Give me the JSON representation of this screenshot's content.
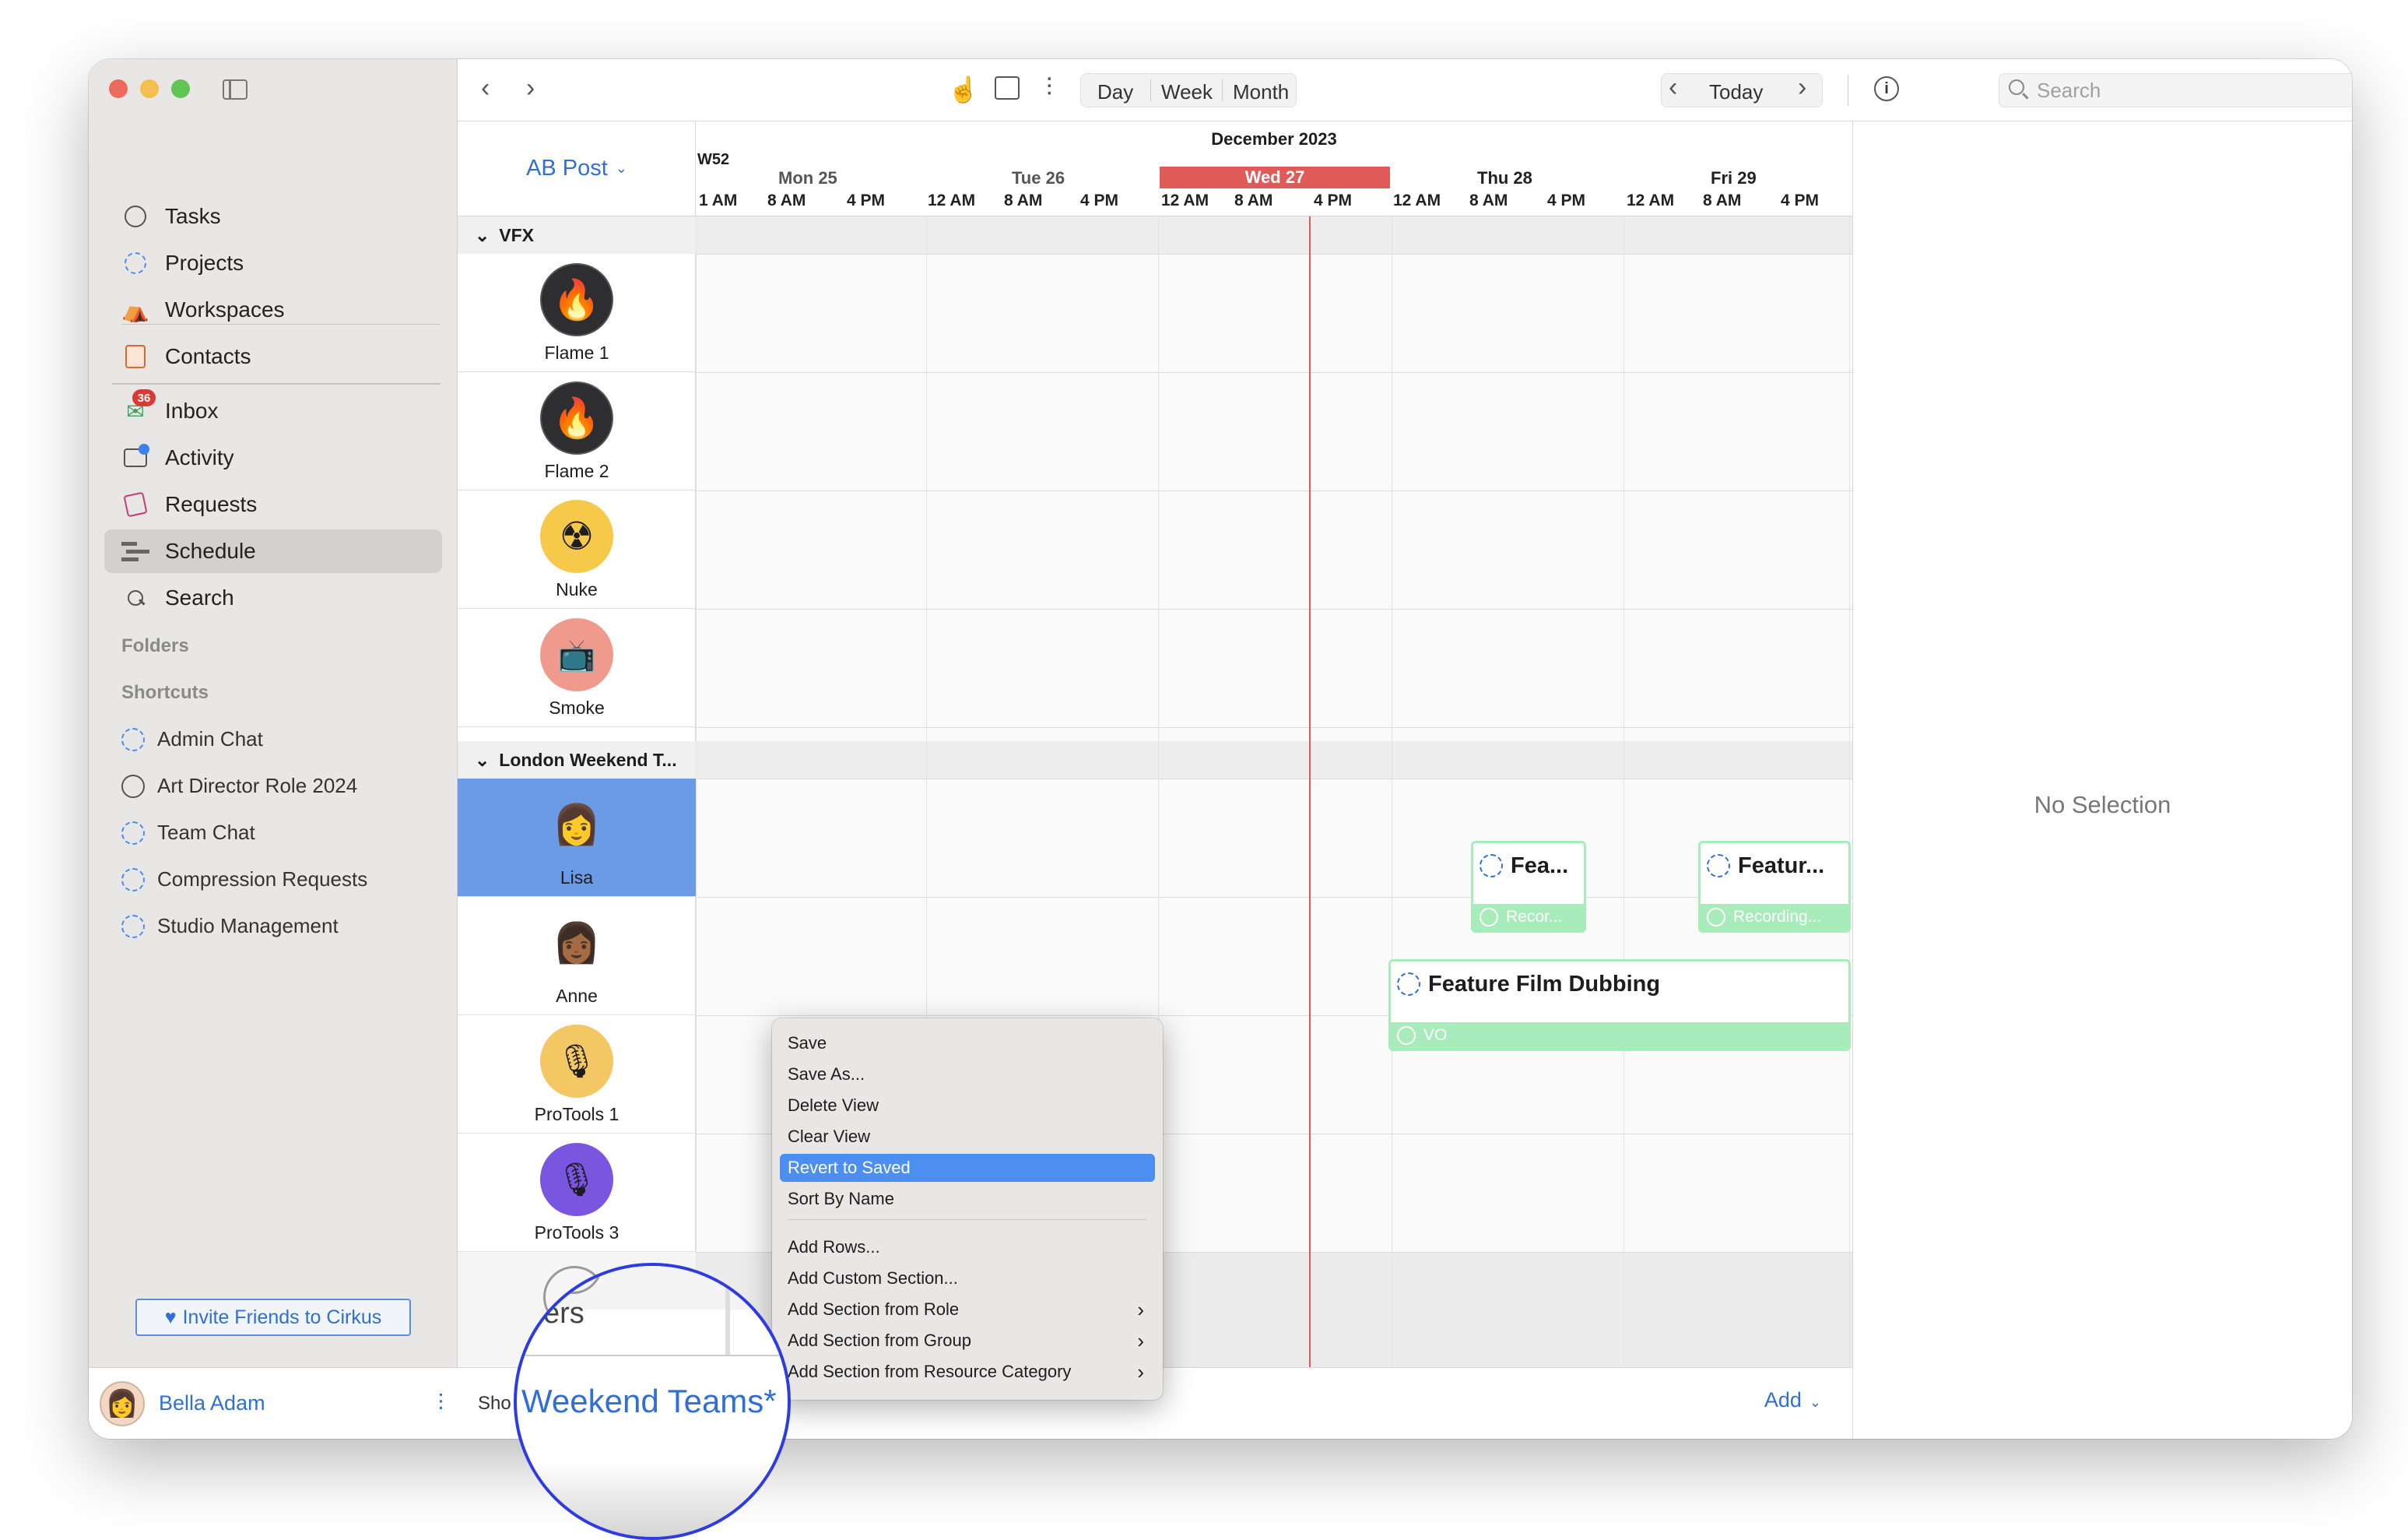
{
  "sidebar": {
    "nav": [
      {
        "label": "Tasks",
        "icon": "circle-icon"
      },
      {
        "label": "Projects",
        "icon": "dashed-circle-icon"
      },
      {
        "label": "Workspaces",
        "icon": "workspaces-icon"
      },
      {
        "label": "Contacts",
        "icon": "contacts-icon"
      },
      {
        "label": "Inbox",
        "icon": "inbox-icon",
        "badge": "36"
      },
      {
        "label": "Activity",
        "icon": "activity-icon"
      },
      {
        "label": "Requests",
        "icon": "requests-icon"
      },
      {
        "label": "Schedule",
        "icon": "schedule-icon",
        "selected": true
      },
      {
        "label": "Search",
        "icon": "search-icon"
      }
    ],
    "folders_label": "Folders",
    "shortcuts_label": "Shortcuts",
    "shortcuts": [
      "Admin Chat",
      "Art Director Role 2024",
      "Team Chat",
      "Compression Requests",
      "Studio Management"
    ],
    "invite_label": "Invite Friends to Cirkus",
    "user_name": "Bella Adam"
  },
  "toolbar": {
    "day": "Day",
    "week": "Week",
    "month": "Month",
    "today": "Today",
    "search_placeholder": "Search"
  },
  "view_title": "AB Post",
  "timeline": {
    "month_label": "December 2023",
    "week_label": "W52",
    "days": [
      {
        "label": "Mon 25",
        "today": false
      },
      {
        "label": "Tue 26",
        "today": false
      },
      {
        "label": "Wed 27",
        "today": true
      },
      {
        "label": "Thu 28",
        "today": false
      },
      {
        "label": "Fri 29",
        "today": false
      }
    ],
    "first_hour": "1 AM",
    "hours": [
      "8 AM",
      "4 PM",
      "12 AM"
    ]
  },
  "groups": [
    {
      "label": "VFX",
      "resources": [
        "Flame 1",
        "Flame 2",
        "Nuke",
        "Smoke"
      ]
    },
    {
      "label": "London Weekend T...",
      "resources": [
        "Lisa",
        "Anne",
        "ProTools 1",
        "ProTools 3"
      ]
    }
  ],
  "events": [
    {
      "title": "Fea...",
      "sub": "Recor..."
    },
    {
      "title": "Featur...",
      "sub": "Recording..."
    },
    {
      "title": "Feature Film Dubbing",
      "sub": "VO"
    }
  ],
  "inspector": {
    "empty": "No Selection"
  },
  "bottom": {
    "show_prefix": "Sho",
    "add_label": "Add"
  },
  "menu": {
    "items": [
      "Save",
      "Save As...",
      "Delete View",
      "Clear View",
      "Revert to Saved",
      "Sort By Name"
    ],
    "items2": [
      "Add Rows...",
      "Add Custom Section...",
      "Add Section from Role",
      "Add Section from Group",
      "Add Section from Resource Category"
    ],
    "highlighted": "Revert to Saved"
  },
  "magnifier": {
    "text": "Weekend Teams*",
    "partial": "ers"
  },
  "colors": {
    "accent": "#2f6fd6",
    "today": "#e05a57",
    "event": "#a8ecbb",
    "selection": "#6b9ae6"
  }
}
